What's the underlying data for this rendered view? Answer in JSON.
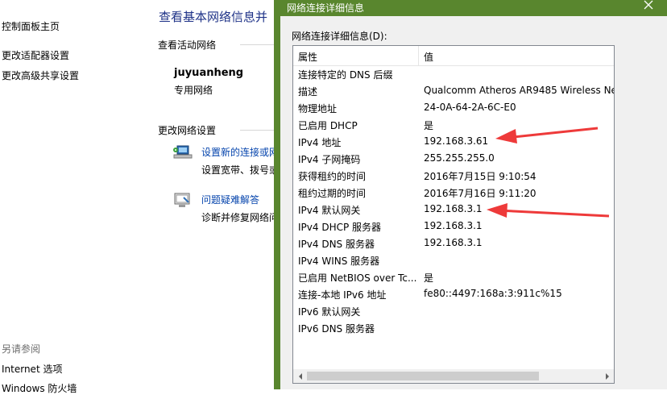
{
  "control_panel": {
    "sidebar": {
      "items": [
        {
          "label": "控制面板主页"
        },
        {
          "label": "更改适配器设置"
        },
        {
          "label": "更改高级共享设置"
        }
      ],
      "see_also_title": "另请参阅",
      "see_also": [
        {
          "label": "Internet 选项"
        },
        {
          "label": "Windows 防火墙"
        }
      ]
    },
    "main": {
      "title": "查看基本网络信息并",
      "active_networks_label": "查看活动网络",
      "network_name": "juyuanheng",
      "network_type": "专用网络",
      "change_settings_label": "更改网络设置",
      "tasks": [
        {
          "link": "设置新的连接或网",
          "desc": "设置宽带、拨号或",
          "icon": "network-setup-icon"
        },
        {
          "link": "问题疑难解答",
          "desc": "诊断并修复网络问",
          "icon": "troubleshoot-icon"
        }
      ]
    }
  },
  "dialog": {
    "title": "网络连接详细信息",
    "caption": "网络连接详细信息(D):",
    "columns": {
      "property": "属性",
      "value": "值"
    },
    "rows": [
      {
        "property": "连接特定的 DNS 后缀",
        "value": ""
      },
      {
        "property": "描述",
        "value": "Qualcomm Atheros AR9485 Wireless Ne"
      },
      {
        "property": "物理地址",
        "value": "24-0A-64-2A-6C-E0"
      },
      {
        "property": "已启用 DHCP",
        "value": "是"
      },
      {
        "property": "IPv4 地址",
        "value": "192.168.3.61"
      },
      {
        "property": "IPv4 子网掩码",
        "value": "255.255.255.0"
      },
      {
        "property": "获得租约的时间",
        "value": "2016年7月15日 9:10:54"
      },
      {
        "property": "租约过期的时间",
        "value": "2016年7月16日 9:11:20"
      },
      {
        "property": "IPv4 默认网关",
        "value": "192.168.3.1"
      },
      {
        "property": "IPv4 DHCP 服务器",
        "value": "192.168.3.1"
      },
      {
        "property": "IPv4 DNS 服务器",
        "value": "192.168.3.1"
      },
      {
        "property": "IPv4 WINS 服务器",
        "value": ""
      },
      {
        "property": "已启用 NetBIOS over Tc...",
        "value": "是"
      },
      {
        "property": "连接-本地 IPv6 地址",
        "value": "fe80::4497:168a:3:911c%15"
      },
      {
        "property": "IPv6 默认网关",
        "value": ""
      },
      {
        "property": "IPv6 DNS 服务器",
        "value": ""
      }
    ]
  },
  "colors": {
    "dialog_frame": "#59862e",
    "link": "#0645ad",
    "heading": "#1e3287",
    "annotation_arrow": "#ee3a3a"
  }
}
